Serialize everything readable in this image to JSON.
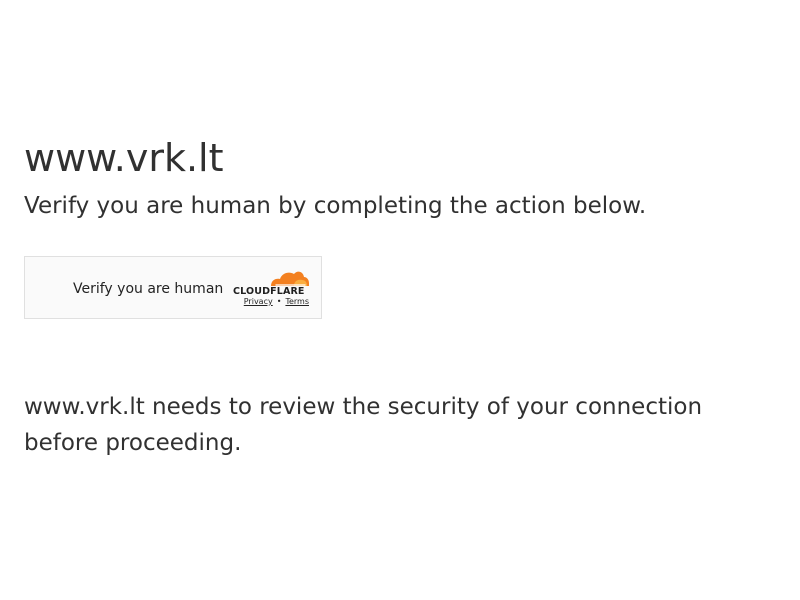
{
  "header": {
    "site_title": "www.vrk.lt",
    "subtitle": "Verify you are human by completing the action below."
  },
  "widget": {
    "label": "Verify you are human",
    "brand": "CLOUDFLARE",
    "links": {
      "privacy": "Privacy",
      "separator": "•",
      "terms": "Terms"
    },
    "colors": {
      "orange": "#F38020",
      "light_orange": "#FAAE40",
      "text": "#232323",
      "background": "#FAFAFA",
      "border": "#E0E0E0"
    }
  },
  "message": {
    "text": "www.vrk.lt needs to review the security of your connection before proceeding."
  }
}
